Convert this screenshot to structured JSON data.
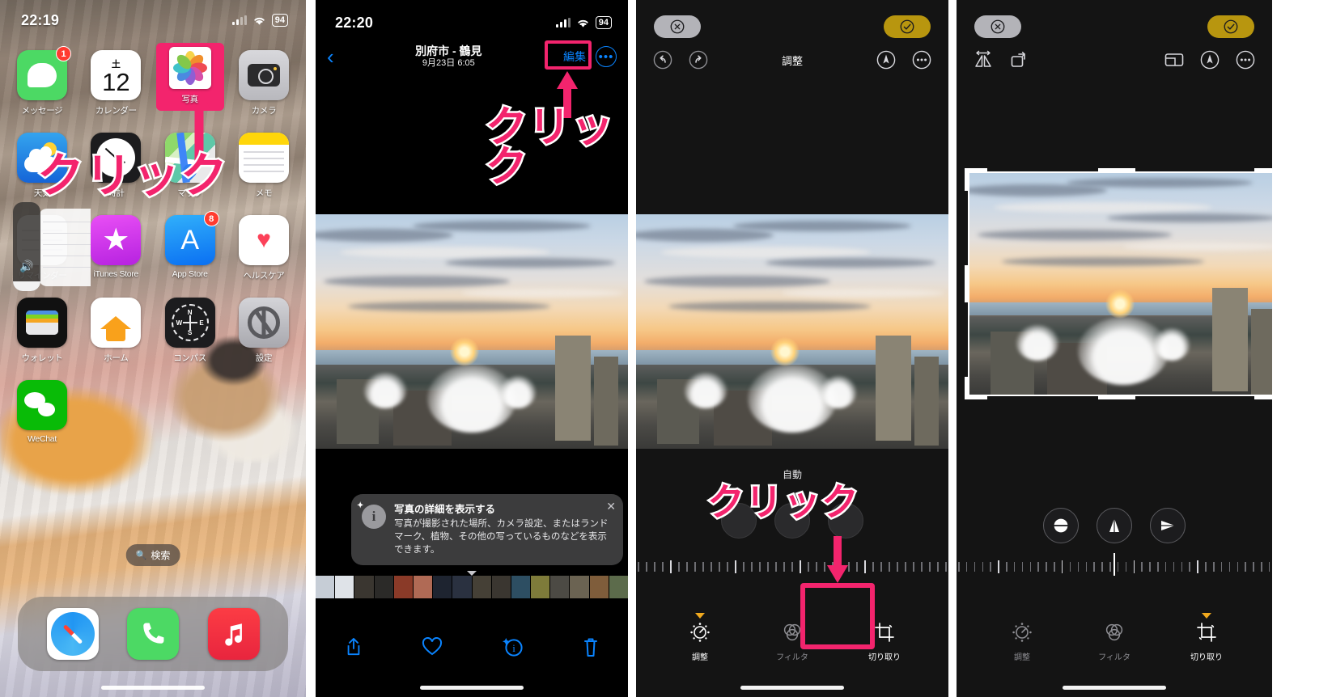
{
  "panel1": {
    "name": "iphone-home-screen",
    "status": {
      "time": "22:19",
      "battery": "94",
      "signal_icon": "cellular-bars-icon",
      "wifi_icon": "wifi-icon"
    },
    "apps": [
      [
        {
          "label": "メッセージ",
          "icon": "messages-icon",
          "badge": "1"
        },
        {
          "label": "カレンダー",
          "icon": "calendar-icon",
          "badge": "",
          "cal_dow": "土",
          "cal_day": "12"
        },
        {
          "label": "写真",
          "icon": "photos-icon",
          "badge": "",
          "highlighted": true
        },
        {
          "label": "カメラ",
          "icon": "camera-icon",
          "badge": ""
        }
      ],
      [
        {
          "label": "天気",
          "icon": "weather-icon",
          "badge": ""
        },
        {
          "label": "時計",
          "icon": "clock-icon",
          "badge": ""
        },
        {
          "label": "マップ",
          "icon": "maps-icon",
          "badge": ""
        },
        {
          "label": "メモ",
          "icon": "notes-icon",
          "badge": ""
        }
      ],
      [
        {
          "label": "リマインダー",
          "icon": "reminders-icon",
          "badge": ""
        },
        {
          "label": "iTunes Store",
          "icon": "itunes-store-icon",
          "badge": ""
        },
        {
          "label": "App Store",
          "icon": "app-store-icon",
          "badge": "8"
        },
        {
          "label": "ヘルスケア",
          "icon": "health-icon",
          "badge": ""
        }
      ],
      [
        {
          "label": "ウォレット",
          "icon": "wallet-icon",
          "badge": ""
        },
        {
          "label": "ホーム",
          "icon": "home-icon",
          "badge": ""
        },
        {
          "label": "コンパス",
          "icon": "compass-icon",
          "badge": ""
        },
        {
          "label": "設定",
          "icon": "settings-icon",
          "badge": ""
        }
      ],
      [
        {
          "label": "WeChat",
          "icon": "wechat-icon",
          "badge": ""
        }
      ]
    ],
    "compass_letters": [
      "N",
      "E",
      "S",
      "W"
    ],
    "search": {
      "label": "検索",
      "icon": "search-icon"
    },
    "dock": [
      {
        "label": "Safari",
        "icon": "safari-icon"
      },
      {
        "label": "電話",
        "icon": "phone-icon"
      },
      {
        "label": "ミュージック",
        "icon": "music-icon"
      }
    ],
    "annotation": "クリック"
  },
  "panel2": {
    "name": "photo-viewer",
    "status": {
      "time": "22:20",
      "battery": "94"
    },
    "nav": {
      "back_icon": "chevron-left-icon",
      "title": "別府市 - 鶴見",
      "subtitle": "9月23日 6:05",
      "edit_label": "編集",
      "more_icon": "ellipsis-circle-icon"
    },
    "annotation": "クリッ\nク",
    "tooltip": {
      "title": "写真の詳細を表示する",
      "body": "写真が撮影された場所、カメラ設定、またはランドマーク、植物、その他の写っているものなどを表示できます。",
      "icon": "sparkle-info-icon",
      "close_icon": "close-icon"
    },
    "toolbar": [
      {
        "icon": "share-icon",
        "label": "共有"
      },
      {
        "icon": "heart-icon",
        "label": "お気に入り"
      },
      {
        "icon": "info-sparkle-icon",
        "label": "情報"
      },
      {
        "icon": "trash-icon",
        "label": "削除"
      }
    ]
  },
  "panel3": {
    "name": "photo-edit-adjust",
    "cancel_icon": "cancel-circle-icon",
    "done_icon": "check-circle-icon",
    "undo_icon": "undo-icon",
    "redo_icon": "redo-icon",
    "title": "調整",
    "markup_icon": "markup-pen-icon",
    "more_icon": "ellipsis-circle-icon",
    "auto_label": "自動",
    "annotation": "クリック",
    "tabs": [
      {
        "label": "調整",
        "icon": "adjust-dial-icon",
        "active": true
      },
      {
        "label": "フィルタ",
        "icon": "filter-circles-icon",
        "active": false
      },
      {
        "label": "切り取り",
        "icon": "crop-icon",
        "active": false,
        "highlighted": true
      }
    ]
  },
  "panel4": {
    "name": "photo-edit-crop",
    "cancel_icon": "cancel-circle-icon",
    "done_icon": "check-circle-icon",
    "flip_icon": "flip-horizontal-icon",
    "rotate_icon": "rotate-icon",
    "aspect_icon": "aspect-ratio-icon",
    "markup_icon": "markup-pen-icon",
    "more_icon": "ellipsis-circle-icon",
    "knobs": [
      {
        "icon": "straighten-icon",
        "label": "傾き補正"
      },
      {
        "icon": "vertical-perspective-icon",
        "label": "垂直方向"
      },
      {
        "icon": "horizontal-perspective-icon",
        "label": "水平方向"
      }
    ],
    "tabs": [
      {
        "label": "調整",
        "icon": "adjust-dial-icon",
        "active": false
      },
      {
        "label": "フィルタ",
        "icon": "filter-circles-icon",
        "active": false
      },
      {
        "label": "切り取り",
        "icon": "crop-icon",
        "active": true
      }
    ]
  },
  "colors": {
    "accent_pink": "#f3246d",
    "ios_blue": "#0a84ff",
    "gold": "#b8960f",
    "amber": "#f0a91e"
  }
}
